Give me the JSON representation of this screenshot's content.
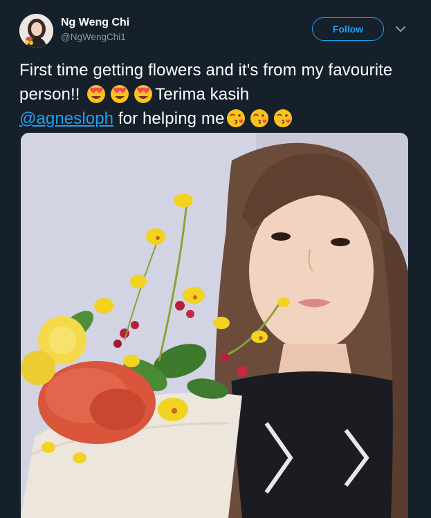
{
  "user": {
    "display_name": "Ng Weng Chi",
    "handle": "@NgWengChi1"
  },
  "follow_label": "Follow",
  "tweet": {
    "text_part1": "First time getting flowers and it's from my favourite person!! ",
    "emoji_group1": [
      "smiling-face-with-heart-eyes",
      "smiling-face-with-heart-eyes",
      "smiling-face-with-heart-eyes"
    ],
    "text_part2": "Terima kasih",
    "mention": "@agnesloph",
    "text_part3": " for helping me",
    "emoji_group2": [
      "face-blowing-a-kiss",
      "face-blowing-a-kiss",
      "face-blowing-a-kiss"
    ]
  },
  "icons": {
    "caret": "chevron-down-icon"
  },
  "colors": {
    "background": "#15202b",
    "accent": "#1da1f2",
    "text": "#ffffff",
    "secondary_text": "#8899a6"
  }
}
